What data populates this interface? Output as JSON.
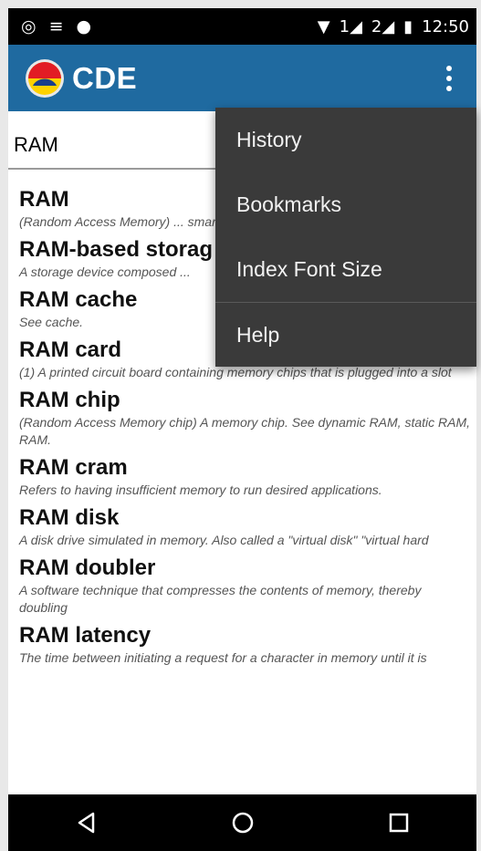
{
  "status_bar": {
    "time": "12:50",
    "sim1": "1",
    "sim2": "2",
    "icons": [
      "whatsapp-icon",
      "notification-icon",
      "location-icon",
      "wifi-icon",
      "signal-icon",
      "battery-icon"
    ]
  },
  "app_bar": {
    "title": "CDE",
    "color": "#1f6aa0",
    "overflow_icon": "more-vert-icon"
  },
  "search": {
    "value": "RAM"
  },
  "entries": [
    {
      "term": "RAM",
      "definition": "(Random Access Memory) ... smartphone or tablet."
    },
    {
      "term": "RAM-based storag",
      "definition": "A storage device composed ..."
    },
    {
      "term": "RAM cache",
      "definition": "See cache."
    },
    {
      "term": "RAM card",
      "definition": "(1) A printed circuit board containing memory chips that is plugged into a slot"
    },
    {
      "term": "RAM chip",
      "definition": "(Random Access Memory chip) A memory chip. See dynamic RAM, static RAM, RAM."
    },
    {
      "term": "RAM cram",
      "definition": "Refers to having insufficient memory to run desired applications."
    },
    {
      "term": "RAM disk",
      "definition": "A disk drive simulated in memory. Also called a \"virtual disk\" \"virtual hard"
    },
    {
      "term": "RAM doubler",
      "definition": "A software technique that compresses the contents of memory, thereby doubling"
    },
    {
      "term": "RAM latency",
      "definition": "The time between initiating a request for a character in memory until it is"
    }
  ],
  "menu": {
    "items": [
      "History",
      "Bookmarks",
      "Index Font Size",
      "Help"
    ]
  },
  "nav_bar": {
    "icons": [
      "back-icon",
      "home-icon",
      "recents-icon"
    ]
  }
}
